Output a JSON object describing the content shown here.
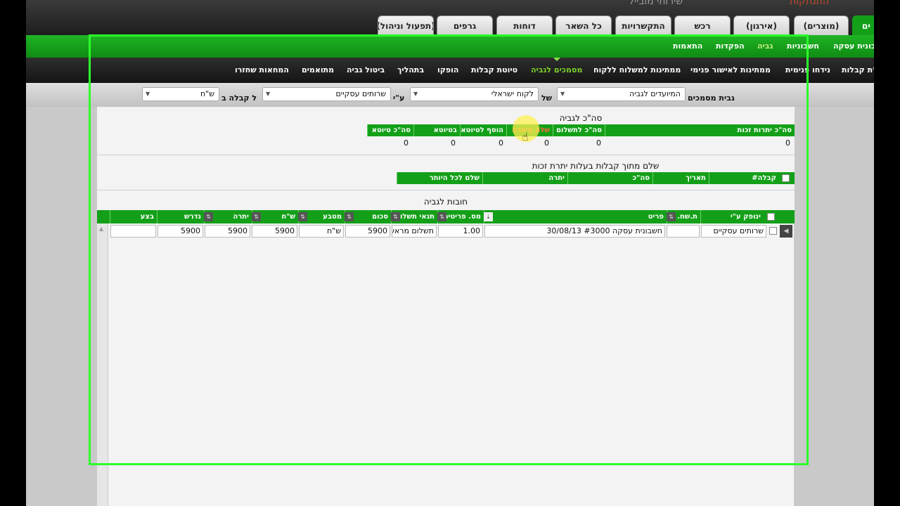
{
  "topbar": {
    "app_title": "שירותי מובייל",
    "right_text": "התנתקות"
  },
  "main_tabs": [
    {
      "label": "ים",
      "active": true
    },
    {
      "label": "(מוצרים)"
    },
    {
      "label": "(אירגון)"
    },
    {
      "label": "רכש"
    },
    {
      "label": "התקשרויות"
    },
    {
      "label": "כל השאר"
    },
    {
      "label": "דוחות"
    },
    {
      "label": "גרפים"
    },
    {
      "label": "(תפעול וניהול)"
    }
  ],
  "sub_tabs": [
    {
      "label": "כונית עסקה"
    },
    {
      "label": "חשבוניות"
    },
    {
      "label": "גביה",
      "selected": true
    },
    {
      "label": "הפקדות"
    },
    {
      "label": "התאמות"
    }
  ],
  "tools": [
    {
      "label": "ת קבלות*"
    },
    {
      "label": "נידחו פנימית"
    },
    {
      "label": "ממתינות לאישור פנימי"
    },
    {
      "label": "ממתינות למשלוח ללקוח"
    },
    {
      "label": "מסמכים לגביה",
      "selected": true
    },
    {
      "label": "טיוטת קבלות"
    },
    {
      "label": "הופקו"
    },
    {
      "label": "בתהליך"
    },
    {
      "label": "ביטול גביה"
    },
    {
      "label": "מתואמים"
    },
    {
      "label": "המחאות שחזרו"
    }
  ],
  "filters": {
    "label_collect": "גבית מסמכים",
    "select_docs": "המיועדים לגביה",
    "label_of": "של",
    "select_customer": "לקוח ישראלי",
    "label_by": "ע\"י",
    "select_service": "שרותים עסקיים",
    "label_receipt": "ל קבלה ב",
    "select_currency": "ש\"ח"
  },
  "summary": {
    "title": "סה\"כ לגביה",
    "headers": [
      "סה\"כ יתרות זכות",
      "סה\"כ לתשלום",
      "שלם מיתרה",
      "הוסף לטיוטא",
      "בטיוטא",
      "סה\"כ טיוטא"
    ],
    "values": [
      "0",
      "0",
      "0",
      "0",
      "0",
      "0"
    ]
  },
  "credit": {
    "title": "שלם מתוך קבלות בעלות יתרת זכות",
    "headers": [
      "קבלה#",
      "תאריך",
      "סה\"כ",
      "יתרה",
      "שלם לכל היותר"
    ]
  },
  "debts": {
    "title": "חובות לגביה",
    "headers": [
      "ינופק ע\"י",
      "ת.שח.",
      "פריט",
      "מס. פריטים",
      "תנאי תשלום",
      "סכום",
      "מטבע",
      "ש\"ח",
      "יתרה",
      "נדרש",
      "בצע"
    ],
    "row": {
      "issued_by": "שרותים עסקיים",
      "date": "",
      "item": "חשבונית עסקה #3000 30/08/13",
      "qty": "1.00",
      "terms": "תשלום מראש",
      "amount": "5900",
      "currency": "ש\"ח",
      "ils": "5900",
      "balance": "5900",
      "required": "5900",
      "exec": ""
    }
  }
}
